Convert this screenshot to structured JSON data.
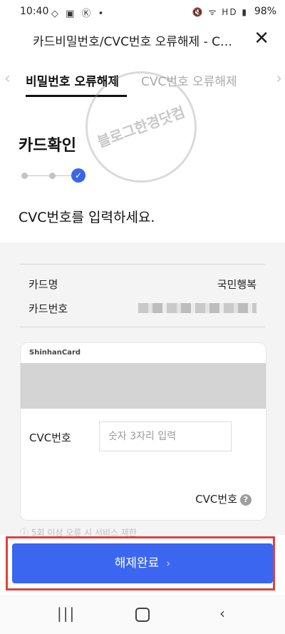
{
  "status_bar": {
    "time": "10:40",
    "left_icons": "◇ ▣ Ⓚ •",
    "right_icons": "🔇 ᯤ HD ▮",
    "battery": "98%"
  },
  "header": {
    "title": "카드비밀번호/CVC번호 오류해제 - C…",
    "close_icon": "✕"
  },
  "tabs": [
    {
      "label": "비밀번호 오류해제",
      "active": true
    },
    {
      "label": "CVC번호 오류해제",
      "active": false
    }
  ],
  "tabs_arrows": {
    "left": "‹",
    "right": "›"
  },
  "section": {
    "title": "카드확인",
    "instruction": "CVC번호를 입력하세요.",
    "step_check": "✓"
  },
  "card_info": {
    "name_label": "카드명",
    "name_value": "국민행복",
    "number_label": "카드번호"
  },
  "card": {
    "brand": "ShinhanCard",
    "cvc_label": "CVC번호",
    "cvc_placeholder": "숫자 3자리 입력",
    "cvc_help_label": "CVC번호",
    "help_icon": "?"
  },
  "notice": "ⓘ 5회 이상 오류 시 서비스 제한",
  "submit": {
    "label": "해제완료",
    "chevron": "›"
  },
  "watermark": "블로그한경닷컴",
  "nav": {
    "recents": "|||",
    "back": "‹"
  }
}
